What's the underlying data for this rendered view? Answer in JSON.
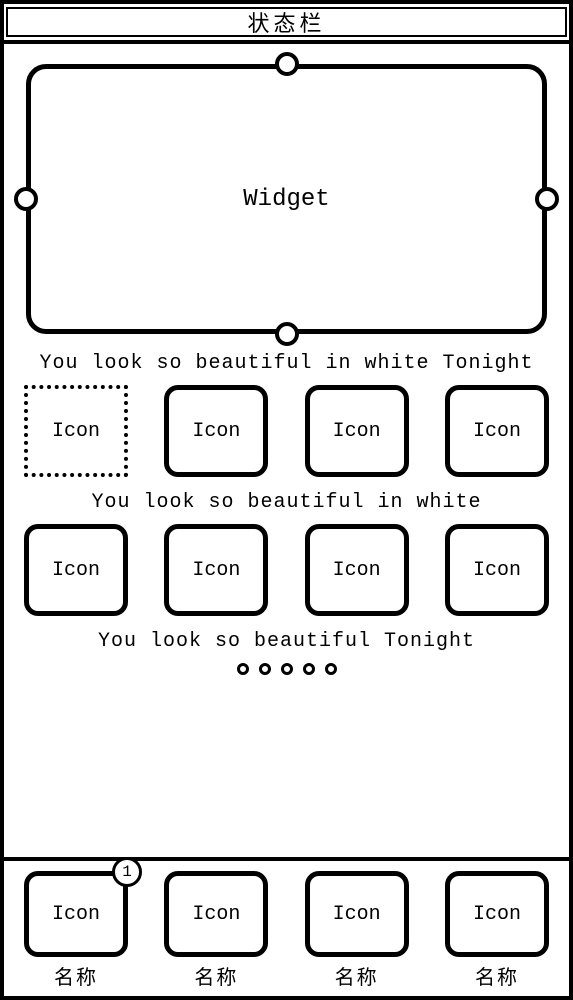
{
  "status_bar": {
    "title": "状态栏"
  },
  "widget": {
    "label": "Widget"
  },
  "rows": [
    {
      "caption": "You look so beautiful in white Tonight",
      "icons": [
        {
          "label": "Icon",
          "dotted": true
        },
        {
          "label": "Icon"
        },
        {
          "label": "Icon"
        },
        {
          "label": "Icon"
        }
      ]
    },
    {
      "caption": "You look so beautiful in white",
      "icons": [
        {
          "label": "Icon"
        },
        {
          "label": "Icon"
        },
        {
          "label": "Icon"
        },
        {
          "label": "Icon"
        }
      ]
    },
    {
      "caption": "You look so beautiful Tonight"
    }
  ],
  "page_indicator": {
    "count": 5
  },
  "dock": {
    "badge": "1",
    "items": [
      {
        "label": "Icon",
        "name": "名称",
        "has_badge": true
      },
      {
        "label": "Icon",
        "name": "名称"
      },
      {
        "label": "Icon",
        "name": "名称"
      },
      {
        "label": "Icon",
        "name": "名称"
      }
    ]
  }
}
